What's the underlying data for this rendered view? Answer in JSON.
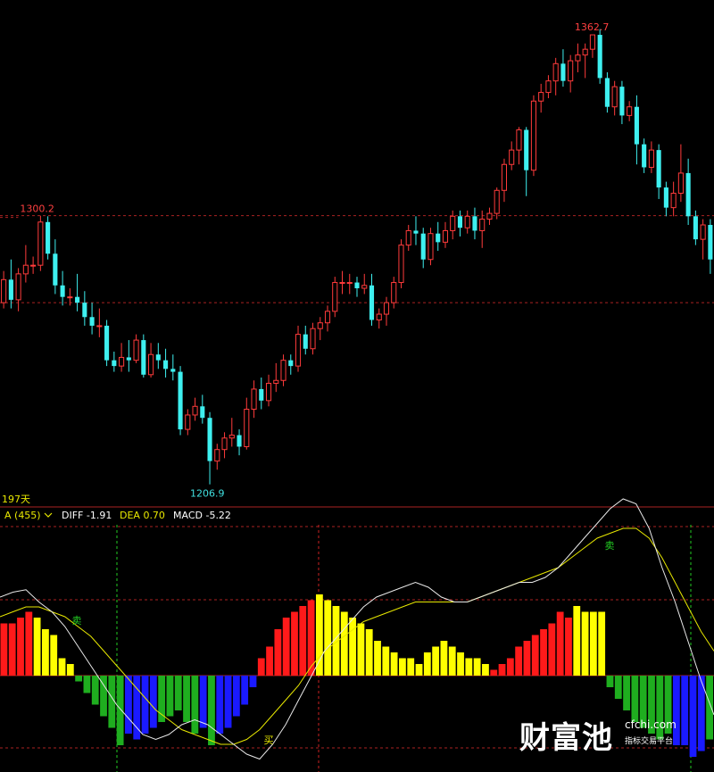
{
  "header": {
    "period": "197天",
    "indicator_name": "A (455)",
    "dropdown_icon": "chevron-down-icon",
    "diff": "DIFF -1.91",
    "dea": "DEA 0.70",
    "macd": "MACD -5.22"
  },
  "colors": {
    "up": "#ff3b3b",
    "down": "#3ef0f0",
    "diff_line": "#e8e8e8",
    "dea_line": "#e8e800",
    "hist_red": "#ff1a1a",
    "hist_yellow": "#ffff00",
    "hist_green": "#1fae1f",
    "hist_blue": "#1a1aff",
    "grid": "#aa2222",
    "signal_vline": "#22cc22",
    "sell_vline": "#cc2222",
    "high_label": "#ff4040",
    "low_label": "#40e0e0"
  },
  "watermark": {
    "brand": "财富池",
    "site": "cfchi.com",
    "slogan": "指标交易平台"
  },
  "chart_data": [
    {
      "type": "candlestick",
      "annotations": {
        "high_1": "1300.2",
        "high_2": "1362.7",
        "low": "1206.9"
      },
      "high_1_value": 1300.2,
      "high_2_value": 1362.7,
      "low_value": 1206.9,
      "grid_levels": [
        1300.2,
        1270.0
      ],
      "candles": [
        [
          1270,
          1278,
          1268,
          1281
        ],
        [
          1278,
          1271,
          1268,
          1285
        ],
        [
          1271,
          1280,
          1267,
          1282
        ],
        [
          1280,
          1283,
          1277,
          1290
        ],
        [
          1283,
          1283,
          1280,
          1286
        ],
        [
          1283,
          1298,
          1281,
          1300.2
        ],
        [
          1298,
          1287,
          1285,
          1300
        ],
        [
          1287,
          1276,
          1273,
          1292
        ],
        [
          1276,
          1272,
          1269,
          1281
        ],
        [
          1272,
          1272,
          1269,
          1275
        ],
        [
          1272,
          1270,
          1267,
          1280
        ],
        [
          1270,
          1265,
          1262,
          1274
        ],
        [
          1265,
          1262,
          1259,
          1270
        ],
        [
          1262,
          1262,
          1258,
          1268
        ],
        [
          1262,
          1250,
          1248,
          1264
        ],
        [
          1250,
          1248,
          1246,
          1253
        ],
        [
          1248,
          1251,
          1246,
          1256
        ],
        [
          1251,
          1250,
          1246,
          1257
        ],
        [
          1250,
          1257,
          1249,
          1259
        ],
        [
          1257,
          1245,
          1244,
          1259
        ],
        [
          1245,
          1252,
          1244,
          1256
        ],
        [
          1252,
          1250,
          1247,
          1256
        ],
        [
          1250,
          1247,
          1244,
          1254
        ],
        [
          1247,
          1246,
          1243,
          1252
        ],
        [
          1246,
          1226,
          1224,
          1248
        ],
        [
          1226,
          1231,
          1224,
          1233
        ],
        [
          1231,
          1234,
          1229,
          1237
        ],
        [
          1234,
          1230,
          1228,
          1238
        ],
        [
          1230,
          1215,
          1206.9,
          1232
        ],
        [
          1215,
          1219,
          1212,
          1221
        ],
        [
          1219,
          1223,
          1216,
          1225
        ],
        [
          1223,
          1224,
          1220,
          1230
        ],
        [
          1224,
          1220,
          1217,
          1226
        ],
        [
          1220,
          1233,
          1219,
          1237
        ],
        [
          1233,
          1240,
          1230,
          1243
        ],
        [
          1240,
          1236,
          1233,
          1244
        ],
        [
          1236,
          1242,
          1234,
          1245
        ],
        [
          1242,
          1243,
          1239,
          1249
        ],
        [
          1243,
          1250,
          1241,
          1252
        ],
        [
          1250,
          1248,
          1245,
          1252
        ],
        [
          1248,
          1259,
          1246,
          1262
        ],
        [
          1259,
          1254,
          1252,
          1262
        ],
        [
          1254,
          1261,
          1252,
          1263
        ],
        [
          1261,
          1263,
          1257,
          1265
        ],
        [
          1263,
          1267,
          1260,
          1269
        ],
        [
          1267,
          1277,
          1265,
          1279
        ],
        [
          1277,
          1277,
          1273,
          1281
        ],
        [
          1277,
          1277,
          1273,
          1280
        ],
        [
          1277,
          1275,
          1272,
          1279
        ],
        [
          1275,
          1276,
          1273,
          1280
        ],
        [
          1276,
          1264,
          1262,
          1280
        ],
        [
          1264,
          1266,
          1261,
          1268
        ],
        [
          1266,
          1270,
          1262,
          1272
        ],
        [
          1270,
          1277,
          1268,
          1279
        ],
        [
          1277,
          1290,
          1275,
          1292
        ],
        [
          1290,
          1295,
          1288,
          1297
        ],
        [
          1295,
          1294,
          1290,
          1300
        ],
        [
          1294,
          1285,
          1282,
          1296
        ],
        [
          1285,
          1294,
          1283,
          1296
        ],
        [
          1294,
          1291,
          1288,
          1298
        ],
        [
          1291,
          1295,
          1289,
          1298
        ],
        [
          1295,
          1300,
          1292,
          1302
        ],
        [
          1300,
          1296,
          1293,
          1302
        ],
        [
          1296,
          1300,
          1294,
          1302
        ],
        [
          1300,
          1295,
          1292,
          1303
        ],
        [
          1295,
          1299,
          1289,
          1302
        ],
        [
          1299,
          1301,
          1297,
          1303
        ],
        [
          1301,
          1309,
          1299,
          1310
        ],
        [
          1309,
          1318,
          1305,
          1320
        ],
        [
          1318,
          1323,
          1316,
          1326
        ],
        [
          1323,
          1330,
          1318,
          1331
        ],
        [
          1330,
          1316,
          1307,
          1331
        ],
        [
          1316,
          1340,
          1314,
          1342
        ],
        [
          1340,
          1343,
          1336,
          1346
        ],
        [
          1343,
          1347,
          1341,
          1349
        ],
        [
          1347,
          1353,
          1342,
          1355
        ],
        [
          1353,
          1347,
          1345,
          1358
        ],
        [
          1347,
          1354,
          1343,
          1356
        ],
        [
          1354,
          1356,
          1350,
          1360
        ],
        [
          1356,
          1358,
          1348,
          1360
        ],
        [
          1358,
          1363,
          1355,
          1362.7
        ],
        [
          1363,
          1348,
          1346,
          1365
        ],
        [
          1348,
          1338,
          1336,
          1350
        ],
        [
          1338,
          1345,
          1335,
          1347
        ],
        [
          1345,
          1335,
          1332,
          1347
        ],
        [
          1335,
          1338,
          1333,
          1340
        ],
        [
          1338,
          1325,
          1318,
          1342
        ],
        [
          1325,
          1317,
          1315,
          1327
        ],
        [
          1317,
          1323,
          1315,
          1326
        ],
        [
          1323,
          1310,
          1306,
          1325
        ],
        [
          1310,
          1303,
          1300,
          1312
        ],
        [
          1303,
          1308,
          1300,
          1312
        ],
        [
          1308,
          1315,
          1305,
          1325
        ],
        [
          1315,
          1300,
          1297,
          1320
        ],
        [
          1300,
          1292,
          1290,
          1302
        ],
        [
          1292,
          1297,
          1285,
          1299
        ],
        [
          1297,
          1285,
          1280,
          1299
        ]
      ]
    },
    {
      "type": "macd",
      "title": "A (455)",
      "diff_current": -1.91,
      "dea_current": 0.7,
      "macd_current": -5.22,
      "signal_markers": [
        "卖",
        "买",
        "卖"
      ],
      "histogram": [
        9,
        9,
        10,
        11,
        10,
        8,
        7,
        3,
        2,
        -1,
        -3,
        -5,
        -7,
        -9,
        -12,
        -10,
        -11,
        -10,
        -9,
        -8,
        -7,
        -6,
        -8,
        -10,
        -9,
        -12,
        -10,
        -9,
        -7,
        -5,
        -2,
        3,
        5,
        8,
        10,
        11,
        12,
        13,
        14,
        13,
        12,
        11,
        10,
        9,
        8,
        6,
        5,
        4,
        3,
        3,
        2,
        4,
        5,
        6,
        5,
        4,
        3,
        3,
        2,
        1,
        2,
        3,
        5,
        6,
        7,
        8,
        9,
        11,
        10,
        12,
        11,
        11,
        11,
        -2,
        -4,
        -6,
        -8,
        -9,
        -10,
        -11,
        -10,
        -12,
        -12,
        -14,
        -13,
        -11
      ],
      "histogram_colors": [
        "r",
        "r",
        "r",
        "r",
        "y",
        "y",
        "y",
        "y",
        "y",
        "g",
        "g",
        "g",
        "g",
        "g",
        "g",
        "b",
        "b",
        "b",
        "b",
        "g",
        "g",
        "g",
        "g",
        "g",
        "b",
        "g",
        "b",
        "b",
        "b",
        "b",
        "b",
        "r",
        "r",
        "r",
        "r",
        "r",
        "r",
        "r",
        "y",
        "y",
        "y",
        "y",
        "y",
        "y",
        "y",
        "y",
        "y",
        "y",
        "y",
        "y",
        "y",
        "y",
        "y",
        "y",
        "y",
        "y",
        "y",
        "y",
        "y",
        "r",
        "r",
        "r",
        "r",
        "r",
        "r",
        "r",
        "r",
        "r",
        "r",
        "y",
        "y",
        "y",
        "y",
        "g",
        "g",
        "g",
        "g",
        "g",
        "g",
        "g",
        "g",
        "b",
        "b",
        "b",
        "b",
        "g"
      ],
      "diff": [
        16,
        17,
        17.5,
        15,
        13,
        10,
        6,
        2,
        -2,
        -6,
        -9,
        -12,
        -13,
        -12,
        -10,
        -9,
        -10,
        -12,
        -14,
        -16,
        -17,
        -14,
        -10,
        -5,
        0,
        5,
        8,
        11,
        14,
        16,
        17,
        18,
        19,
        18,
        16,
        15,
        15,
        16,
        17,
        18,
        19,
        19,
        20,
        22,
        25,
        28,
        31,
        34,
        36,
        35,
        30,
        22,
        15,
        7,
        -1,
        -8
      ],
      "dea": [
        12,
        13,
        14,
        14,
        13,
        12,
        10,
        8,
        5,
        2,
        -1,
        -4,
        -7,
        -9,
        -11,
        -12,
        -13,
        -14,
        -14,
        -13,
        -11,
        -8,
        -5,
        -2,
        2,
        5,
        7,
        9,
        11,
        12,
        13,
        14,
        15,
        15,
        15,
        15,
        15,
        16,
        17,
        18,
        19,
        20,
        21,
        22,
        24,
        26,
        28,
        29,
        30,
        30,
        28,
        24,
        19,
        14,
        9,
        5
      ]
    }
  ]
}
